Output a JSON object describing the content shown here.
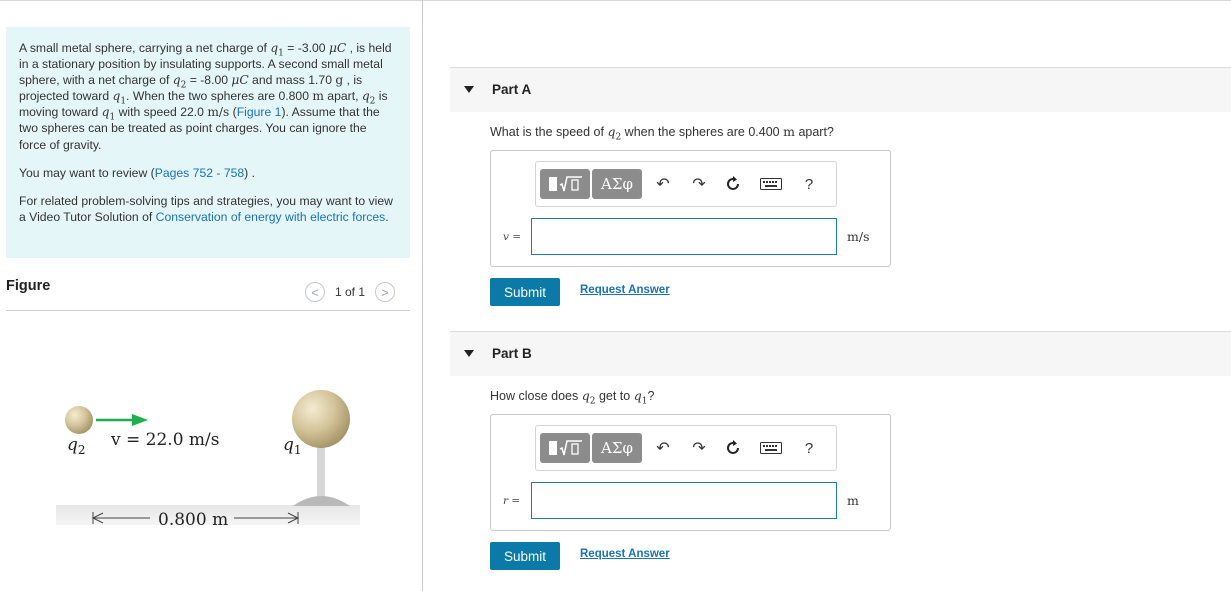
{
  "problem": {
    "p1": {
      "t1": "A small metal sphere, carrying a net charge of ",
      "q1_var": "q",
      "q1_sub": "1",
      "t2": " = -3.00 ",
      "mu1": "μC",
      "t3": " , is held in a stationary position by insulating supports. A second small metal sphere, with a net charge of ",
      "q2_var": "q",
      "q2_sub": "2",
      "t4": " = -8.00 ",
      "mu2": "μC",
      "t5": " and mass 1.70 ",
      "g": "g",
      "t6": " , is projected toward ",
      "q1b_var": "q",
      "q1b_sub": "1",
      "t7": ". When the two spheres are 0.800 ",
      "m1": "m",
      "t8": " apart, ",
      "q2b_var": "q",
      "q2b_sub": "2",
      "t9": " is moving toward ",
      "q1c_var": "q",
      "q1c_sub": "1",
      "t10": " with speed 22.0 ",
      "ms": "m/s",
      "t11": " (",
      "fig_link": "Figure 1",
      "t12": "). Assume that the two spheres can be treated as point charges. You can ignore the force of gravity."
    },
    "p2": {
      "t1": "You may want to review (",
      "link": "Pages 752 - 758",
      "t2": ") ."
    },
    "p3": {
      "t1": "For related problem-solving tips and strategies, you may want to view a Video Tutor Solution of ",
      "link": "Conservation of energy with electric forces",
      "t2": "."
    }
  },
  "figure": {
    "title": "Figure",
    "pager": "1 of 1",
    "prev": "<",
    "next": ">",
    "q2_label": "q",
    "q2_sub": "2",
    "q1_label": "q",
    "q1_sub": "1",
    "v_label": "v = 22.0 m/s",
    "dist_label": "0.800 m"
  },
  "parts": [
    {
      "label": "Part A",
      "question": {
        "t1": "What is the speed of ",
        "var": "q",
        "sub": "2",
        "t2": " when the spheres are 0.400 ",
        "unit_m": "m",
        "t3": " apart?"
      },
      "var_label": "v =",
      "unit": "m/s",
      "input_value": "",
      "submit": "Submit",
      "request": "Request Answer"
    },
    {
      "label": "Part B",
      "question": {
        "t1": "How close does ",
        "var": "q",
        "sub": "2",
        "t2": " get to ",
        "var2": "q",
        "sub2": "1",
        "t3": "?"
      },
      "var_label": "r =",
      "unit": "m",
      "input_value": "",
      "submit": "Submit",
      "request": "Request Answer"
    }
  ],
  "toolbar": {
    "template_icon": "template-fraction-sqrt-icon",
    "greek_label": "ΑΣφ",
    "undo_icon": "undo-icon",
    "redo_icon": "redo-icon",
    "reset_icon": "reset-icon",
    "keyboard_icon": "keyboard-icon",
    "help_label": "?"
  },
  "colors": {
    "problem_bg": "#e5f6f8",
    "link": "#1b72b5",
    "submit_bg": "#0b7aa8",
    "input_border": "#1e7ea6",
    "arrow_green": "#1fae4b"
  }
}
